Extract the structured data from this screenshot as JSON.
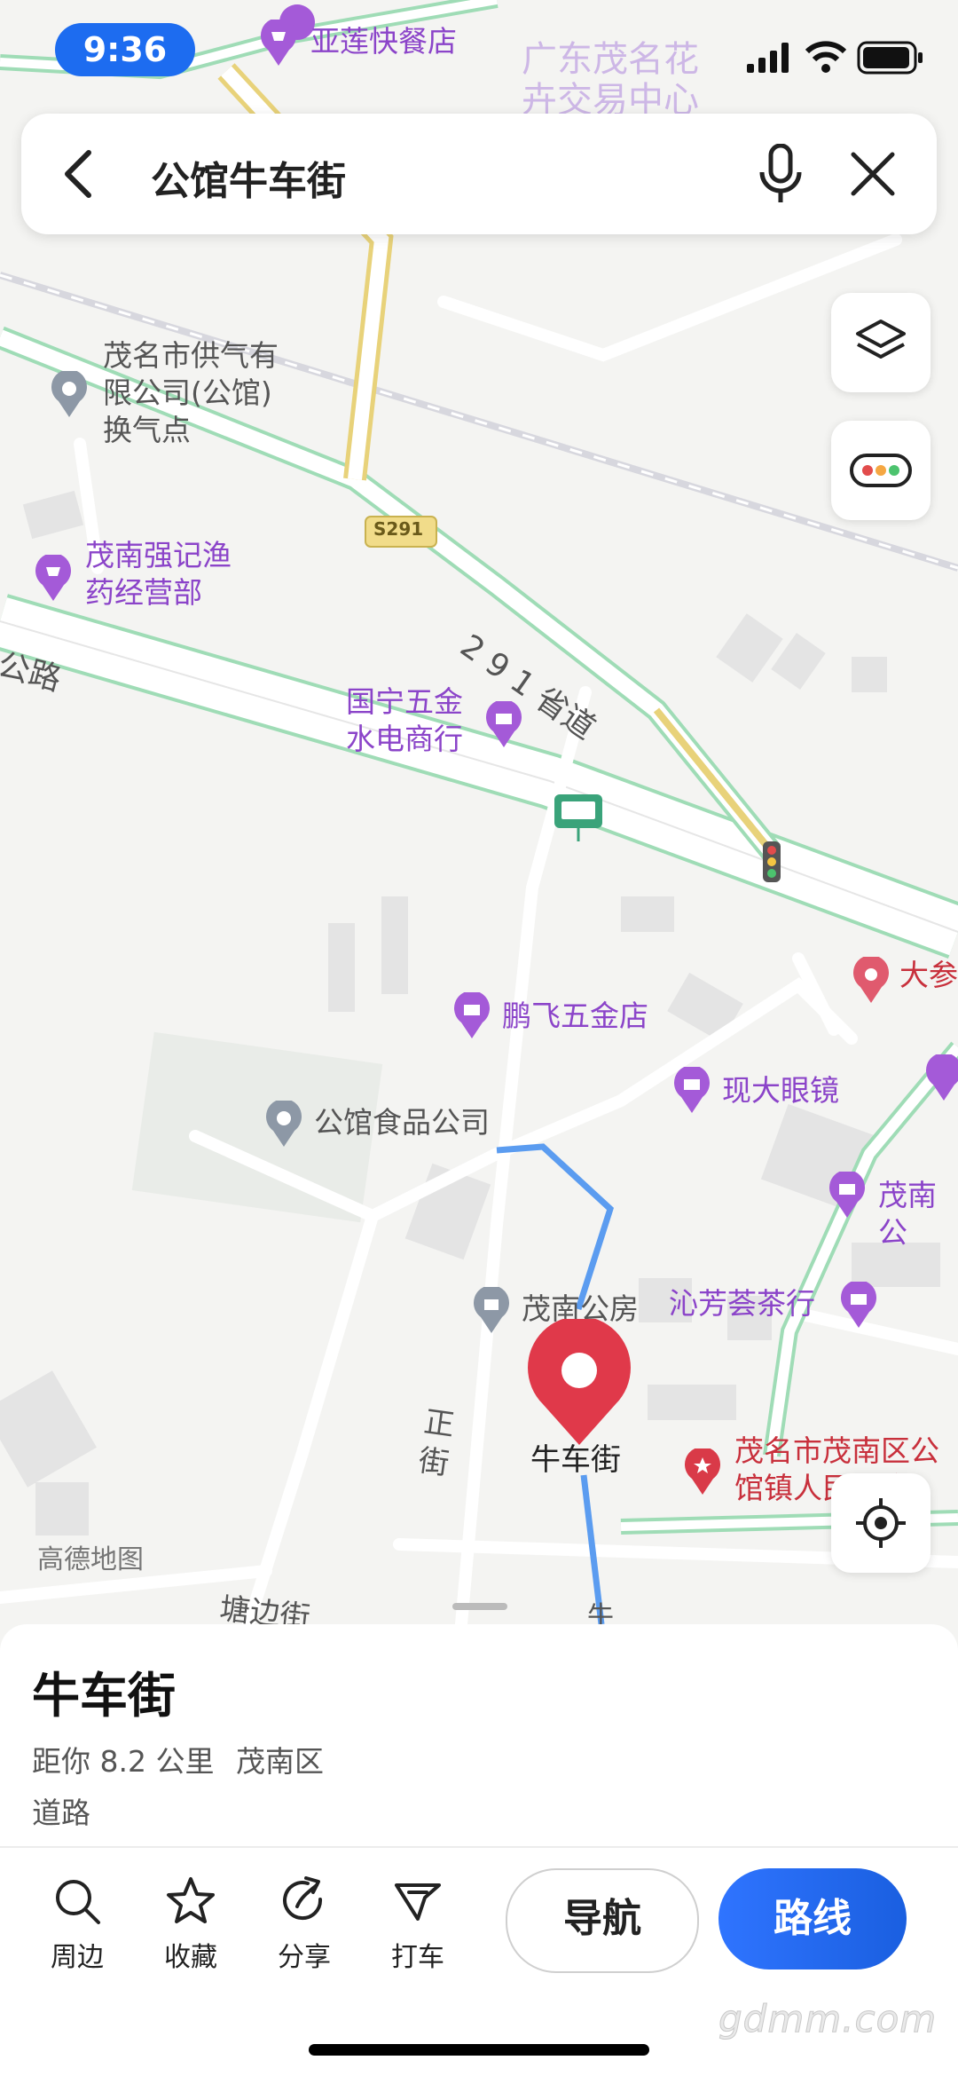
{
  "status": {
    "time": "9:36"
  },
  "search": {
    "query": "公馆牛车街"
  },
  "map": {
    "pois": {
      "yalian": "亚莲快餐店",
      "flower_center": "广东茂名花\n卉交易中心",
      "gas": "茂名市供气有\n限公司(公馆)\n换气点",
      "fishery": "茂南强记渔\n药经营部",
      "hardware1": "国宁五金\n水电商行",
      "dashen": "大参",
      "pengfei": "鹏飞五金店",
      "glasses": "现大眼镜",
      "food_co": "公馆食品公司",
      "maonan_right": "茂南公",
      "housing": "茂南公房",
      "tea": "沁芳荟茶行",
      "gov": "茂名市茂南区公\n馆镇人民政府",
      "selected": "牛车街"
    },
    "roads": {
      "shield": "S291",
      "provincial": "2 9 1 省道",
      "west_road": "公路",
      "zheng_street": "正\n街",
      "tangbian": "塘边街",
      "niu_bottom": "牛"
    },
    "provider_logo": "高德地图"
  },
  "place": {
    "name": "牛车街",
    "distance": "距你 8.2 公里",
    "district": "茂南区",
    "type": "道路"
  },
  "actions": {
    "nearby": "周边",
    "favorite": "收藏",
    "share": "分享",
    "taxi": "打车",
    "navigate": "导航",
    "route": "路线"
  },
  "watermark": "gdmm.com",
  "colors": {
    "accent": "#2f74ff",
    "poi": "#8b44c9",
    "pin": "#e0394a",
    "road": "#9fdcb6",
    "highway": "#e8d27a"
  }
}
